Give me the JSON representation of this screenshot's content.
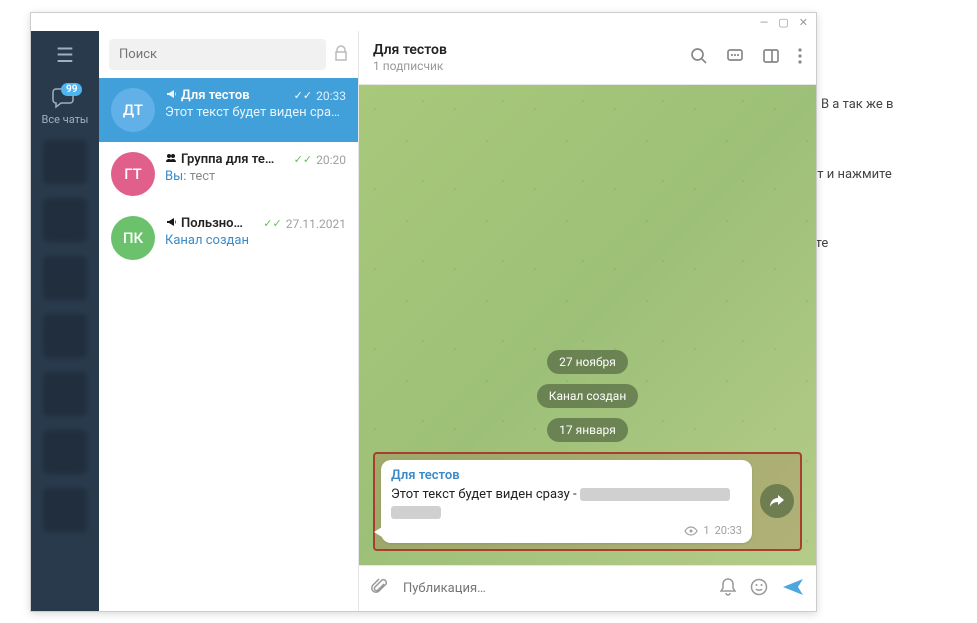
{
  "bg": {
    "p1": "елеграмме. В а так же в",
    "p2": "напишите ст и нажмите",
    "p3": "ст и нажмите"
  },
  "titlebar": {
    "min": "—",
    "max": "▢",
    "close": "✕"
  },
  "sidebar": {
    "all_chats_label": "Все чаты",
    "badge": "99"
  },
  "search": {
    "placeholder": "Поиск"
  },
  "chats": [
    {
      "initials": "ДТ",
      "color": "#62b0e8",
      "name": "Для тестов",
      "time": "20:33",
      "preview": "Этот текст будет виден сраз…",
      "type": "channel",
      "checks": "✓✓",
      "active": true
    },
    {
      "initials": "ГТ",
      "color": "#e05f8b",
      "name": "Группа для те…",
      "time": "20:20",
      "you": "Вы:",
      "preview": "тест",
      "type": "group",
      "checks": "✓✓",
      "active": false
    },
    {
      "initials": "ПК",
      "color": "#6cc26c",
      "name": "Пользно…",
      "time": "27.11.2021",
      "preview": "Канал создан",
      "type": "channel",
      "checks": "✓✓",
      "active": false,
      "link_style": true
    }
  ],
  "header": {
    "title": "Для тестов",
    "subtitle": "1 подписчик"
  },
  "conversation": {
    "pills": [
      "27 ноября",
      "Канал создан",
      "17 января"
    ],
    "message": {
      "sender": "Для тестов",
      "text_prefix": "Этот текст будет виден сразу - ",
      "views": "1",
      "time": "20:33"
    }
  },
  "composer": {
    "placeholder": "Публикация…"
  }
}
